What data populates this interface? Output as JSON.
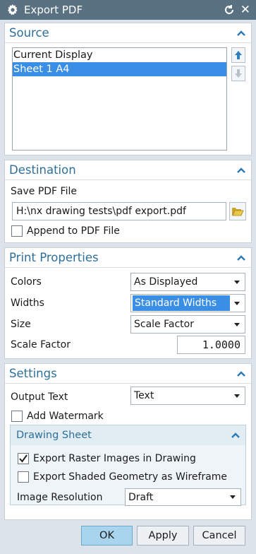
{
  "window": {
    "title": "Export PDF",
    "icons": [
      "gear-icon",
      "reset-icon",
      "close-icon"
    ]
  },
  "source": {
    "title": "Source",
    "items": [
      {
        "label": "Current Display",
        "selected": false
      },
      {
        "label": "Sheet 1  A4",
        "selected": true
      }
    ]
  },
  "destination": {
    "title": "Destination",
    "save_label": "Save PDF File",
    "file_path": "H:\\nx drawing tests\\pdf export.pdf",
    "append_label": "Append to PDF File",
    "append_checked": false
  },
  "print_properties": {
    "title": "Print Properties",
    "colors_label": "Colors",
    "colors_value": "As Displayed",
    "widths_label": "Widths",
    "widths_value": "Standard Widths",
    "size_label": "Size",
    "size_value": "Scale Factor",
    "scale_label": "Scale Factor",
    "scale_value": "1.0000"
  },
  "settings": {
    "title": "Settings",
    "output_label": "Output Text",
    "output_value": "Text",
    "watermark_label": "Add Watermark",
    "watermark_checked": false,
    "drawing_sheet": {
      "title": "Drawing Sheet",
      "raster_label": "Export Raster Images in Drawing",
      "raster_checked": true,
      "shaded_label": "Export Shaded Geometry as Wireframe",
      "shaded_checked": false,
      "resolution_label": "Image Resolution",
      "resolution_value": "Draft"
    }
  },
  "buttons": {
    "ok": "OK",
    "apply": "Apply",
    "cancel": "Cancel"
  },
  "colors": {
    "titlebar": "#5a7181",
    "accent": "#2e6f99",
    "selection": "#3a8ee6"
  }
}
